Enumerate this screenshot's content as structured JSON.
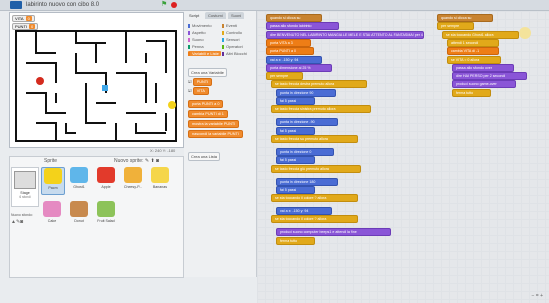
{
  "app": {
    "title": "labirinto nuovo con cibo 8.0"
  },
  "stage": {
    "variables": [
      {
        "name": "VITA",
        "value": "0"
      },
      {
        "name": "PUNTI",
        "value": "0"
      }
    ],
    "coords": "X: 240  Y: -180"
  },
  "sprites": {
    "label": "Sprite",
    "new_sprite_label": "Nuovo sprite:",
    "stage_label": "Stage",
    "stage_sub": "6 sfondi",
    "new_backdrop_label": "Nuovo sfondo:",
    "items": [
      {
        "name": "Pacm",
        "color": "#f4d21a"
      },
      {
        "name": "Ghost1",
        "color": "#5fb6ea"
      },
      {
        "name": "Apple",
        "color": "#e23a2b"
      },
      {
        "name": "Cheesy-P...",
        "color": "#f0b13a"
      },
      {
        "name": "Bananas",
        "color": "#f5d64a"
      },
      {
        "name": "Cake",
        "color": "#e58ac2"
      },
      {
        "name": "Donut",
        "color": "#c88a4e"
      },
      {
        "name": "Fruit Salad",
        "color": "#8dc35a"
      }
    ]
  },
  "palette": {
    "tabs": [
      "Script",
      "Costumi",
      "Suoni"
    ],
    "categories": [
      {
        "label": "Movimento",
        "color": "#4a6cd4"
      },
      {
        "label": "Eventi",
        "color": "#c88330"
      },
      {
        "label": "Aspetto",
        "color": "#8a55d7"
      },
      {
        "label": "Controllo",
        "color": "#e1a91a"
      },
      {
        "label": "Suono",
        "color": "#cf63cf"
      },
      {
        "label": "Sensori",
        "color": "#2ca5e2"
      },
      {
        "label": "Penna",
        "color": "#0e9a6c"
      },
      {
        "label": "Operatori",
        "color": "#5cb712"
      },
      {
        "label": "Variabili e Liste",
        "color": "#ee7d16"
      },
      {
        "label": "Altri Blocchi",
        "color": "#632d99"
      }
    ],
    "make_variable": "Crea una Variabile",
    "variables": [
      "PUNTI",
      "VITA"
    ],
    "blocks": [
      "porta PUNTI a 0",
      "cambia PUNTI di 1",
      "mostra la variabile PUNTI",
      "nascondi la variabile PUNTI"
    ],
    "make_list": "Crea una Lista"
  },
  "scripts": {
    "left": [
      {
        "t": "quando si clicca su",
        "c": "ev"
      },
      {
        "t": "passa allo sfondo labirinto",
        "c": "lo"
      },
      {
        "t": "dire BENVENUTO NEL LABIRINTO MANGIA LE MELE E STAI ATTENTO AL FANTASMA! per 4 secondi",
        "c": "lo"
      },
      {
        "t": "porta VITA a 3",
        "c": "va"
      },
      {
        "t": "porta PUNTI a 0",
        "c": "va"
      },
      {
        "t": "vai a x: -150 y: 94",
        "c": "mo"
      },
      {
        "t": "porta dimensione al 25 %",
        "c": "lo"
      },
      {
        "t": "per sempre",
        "c": "ct"
      },
      {
        "t": "se tasto freccia destra premuto allora",
        "c": "ct"
      },
      {
        "t": "punta in direzione 90",
        "c": "mo"
      },
      {
        "t": "fai 5 passi",
        "c": "mo"
      },
      {
        "t": "se tasto freccia sinistra premuto allora",
        "c": "ct"
      },
      {
        "t": "punta in direzione -90",
        "c": "mo"
      },
      {
        "t": "fai 5 passi",
        "c": "mo"
      },
      {
        "t": "se tasto freccia su premuto allora",
        "c": "ct"
      },
      {
        "t": "punta in direzione 0",
        "c": "mo"
      },
      {
        "t": "fai 5 passi",
        "c": "mo"
      },
      {
        "t": "se tasto freccia giù premuto allora",
        "c": "ct"
      },
      {
        "t": "punta in direzione 180",
        "c": "mo"
      },
      {
        "t": "fai 5 passi",
        "c": "mo"
      },
      {
        "t": "se sta toccando il colore ? allora",
        "c": "ct"
      },
      {
        "t": "vai a x: -150 y: 94",
        "c": "mo"
      },
      {
        "t": "se sta toccando il colore ? allora",
        "c": "ct"
      },
      {
        "t": "produci suono computer beeps1 e attendi la fine",
        "c": "lo"
      },
      {
        "t": "ferma tutto",
        "c": "ct"
      }
    ],
    "right": [
      {
        "t": "quando si clicca su",
        "c": "ev"
      },
      {
        "t": "per sempre",
        "c": "ct"
      },
      {
        "t": "se sta toccando Ghost1 allora",
        "c": "ct"
      },
      {
        "t": "attendi 1 secondi",
        "c": "ct"
      },
      {
        "t": "cambia VITA di -1",
        "c": "va"
      },
      {
        "t": "se VITA = 0 allora",
        "c": "ct"
      },
      {
        "t": "passa allo sfondo over",
        "c": "lo"
      },
      {
        "t": "dire HAI PERSO per 2 secondi",
        "c": "lo"
      },
      {
        "t": "produci suono game-over",
        "c": "lo"
      },
      {
        "t": "ferma tutto",
        "c": "ct"
      }
    ],
    "zoom": "= ",
    "zoom_icons": "− = +"
  }
}
